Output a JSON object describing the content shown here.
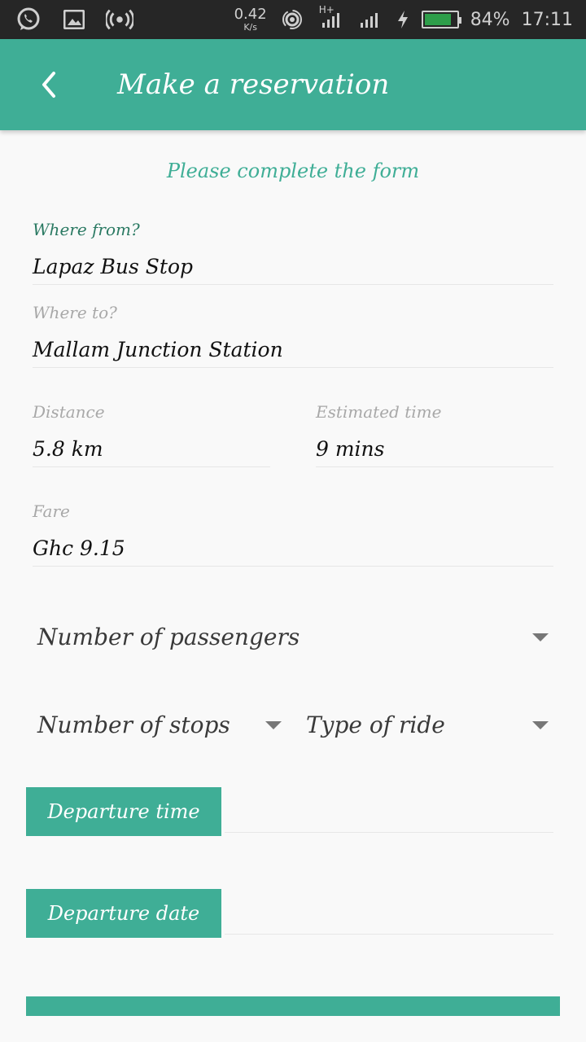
{
  "status_bar": {
    "speed_value": "0.42",
    "speed_unit": "K/s",
    "network_type": "H+",
    "battery_percent": "84%",
    "battery_level": 0.84,
    "time": "17:11",
    "icons": [
      "whatsapp-icon",
      "image-icon",
      "hotspot-icon",
      "wifi-hotspot-icon",
      "signal-icon",
      "signal-icon-2",
      "charging-icon",
      "battery-icon"
    ]
  },
  "app_bar": {
    "title": "Make a reservation",
    "back_icon": "chevron-left-icon",
    "color": "#3fae96"
  },
  "form": {
    "subtitle": "Please complete the form",
    "where_from": {
      "label": "Where from?",
      "value": "Lapaz Bus Stop"
    },
    "where_to": {
      "label": "Where to?",
      "value": "Mallam Junction Station"
    },
    "distance": {
      "label": "Distance",
      "value": "5.8 km"
    },
    "estimated_time": {
      "label": "Estimated time",
      "value": "9 mins"
    },
    "fare": {
      "label": "Fare",
      "value": "Ghc 9.15"
    },
    "passengers": {
      "label": "Number of passengers"
    },
    "stops": {
      "label": "Number of stops"
    },
    "ride_type": {
      "label": "Type of ride"
    },
    "departure_time_button": "Departure time",
    "departure_date_button": "Departure date"
  }
}
